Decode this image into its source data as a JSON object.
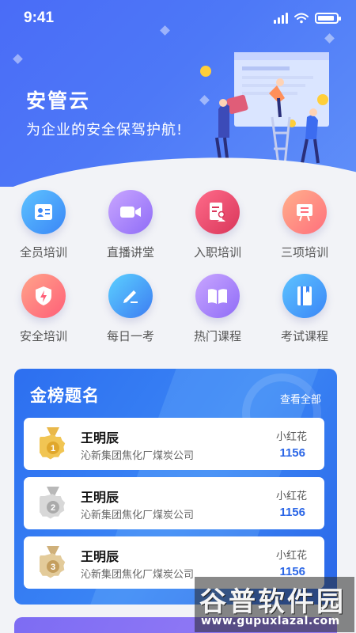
{
  "status_bar": {
    "time": "9:41"
  },
  "hero": {
    "title": "安管云",
    "subtitle": "为企业的安全保驾护航!"
  },
  "features": [
    {
      "label": "全员培训",
      "icon": "id-card-icon",
      "color_from": "#5ec3ff",
      "color_to": "#3a86f7"
    },
    {
      "label": "直播讲堂",
      "icon": "video-icon",
      "color_from": "#c9a6ff",
      "color_to": "#8f6cf7"
    },
    {
      "label": "入职培训",
      "icon": "document-user-icon",
      "color_from": "#ff6b8a",
      "color_to": "#d9365a"
    },
    {
      "label": "三项培训",
      "icon": "board-icon",
      "color_from": "#ffb08c",
      "color_to": "#ff6f7c"
    },
    {
      "label": "安全培训",
      "icon": "shield-bolt-icon",
      "color_from": "#ffa48a",
      "color_to": "#ff5f78"
    },
    {
      "label": "每日一考",
      "icon": "pencil-icon",
      "color_from": "#5cd0ff",
      "color_to": "#3c7cf2"
    },
    {
      "label": "热门课程",
      "icon": "open-book-icon",
      "color_from": "#c9a6ff",
      "color_to": "#8f6cf7"
    },
    {
      "label": "考试课程",
      "icon": "book-icon",
      "color_from": "#5ec3ff",
      "color_to": "#3a86f7"
    }
  ],
  "ranking": {
    "title": "金榜题名",
    "more_label": "查看全部",
    "rows": [
      {
        "rank": "1",
        "name": "王明辰",
        "company": "沁新集团焦化厂煤炭公司",
        "tag": "小红花",
        "score": "1156",
        "medal": "gold"
      },
      {
        "rank": "2",
        "name": "王明辰",
        "company": "沁新集团焦化厂煤炭公司",
        "tag": "小红花",
        "score": "1156",
        "medal": "silver"
      },
      {
        "rank": "3",
        "name": "王明辰",
        "company": "沁新集团焦化厂煤炭公司",
        "tag": "小红花",
        "score": "1156",
        "medal": "bronze"
      }
    ]
  },
  "watermark": {
    "cn": "谷普软件园",
    "en": "www.gupuxlazal.com"
  },
  "colors": {
    "primary": "#4a6cf7",
    "score": "#2b66e6"
  }
}
